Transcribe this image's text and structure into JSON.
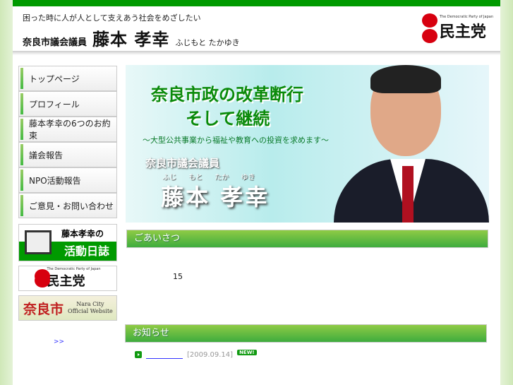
{
  "header": {
    "slogan": "困った時に人が人として支えあう社会をめざしたい",
    "role": "奈良市議会議員",
    "name": "藤本 孝幸",
    "kana": "ふじもと たかゆき",
    "party_en": "The Democratic Party of Japan",
    "party_jp": "民主党"
  },
  "nav": [
    {
      "label": "トップページ"
    },
    {
      "label": "プロフィール"
    },
    {
      "label": "藤本孝幸の6つのお約束"
    },
    {
      "label": "議会報告"
    },
    {
      "label": "NPO活動報告"
    },
    {
      "label": "ご意見・お問い合わせ"
    }
  ],
  "banners": {
    "diary_top": "藤本孝幸の",
    "diary_bottom": "活動日誌",
    "dpj_en": "The Democratic Party of Japan",
    "dpj_jp": "民主党",
    "nara_jp": "奈良市",
    "nara_en1": "Nara City",
    "nara_en2": "Official Website"
  },
  "more_link": ">>",
  "hero": {
    "line1": "奈良市政の改革断行",
    "line2": "そして継続",
    "sub": "〜大型公共事業から福祉や教育への投資を求めます〜",
    "role": "奈良市議会議員",
    "kana": "ふじ もと たか ゆき",
    "name": "藤本 孝幸"
  },
  "greeting": {
    "title": "ごあいさつ",
    "text": "15"
  },
  "news": {
    "title": "お知らせ",
    "items": [
      {
        "date": "[2009.09.14]",
        "badge": "NEW!"
      }
    ]
  },
  "colors": {
    "brand_green": "#009a00",
    "party_red": "#d7000f"
  }
}
